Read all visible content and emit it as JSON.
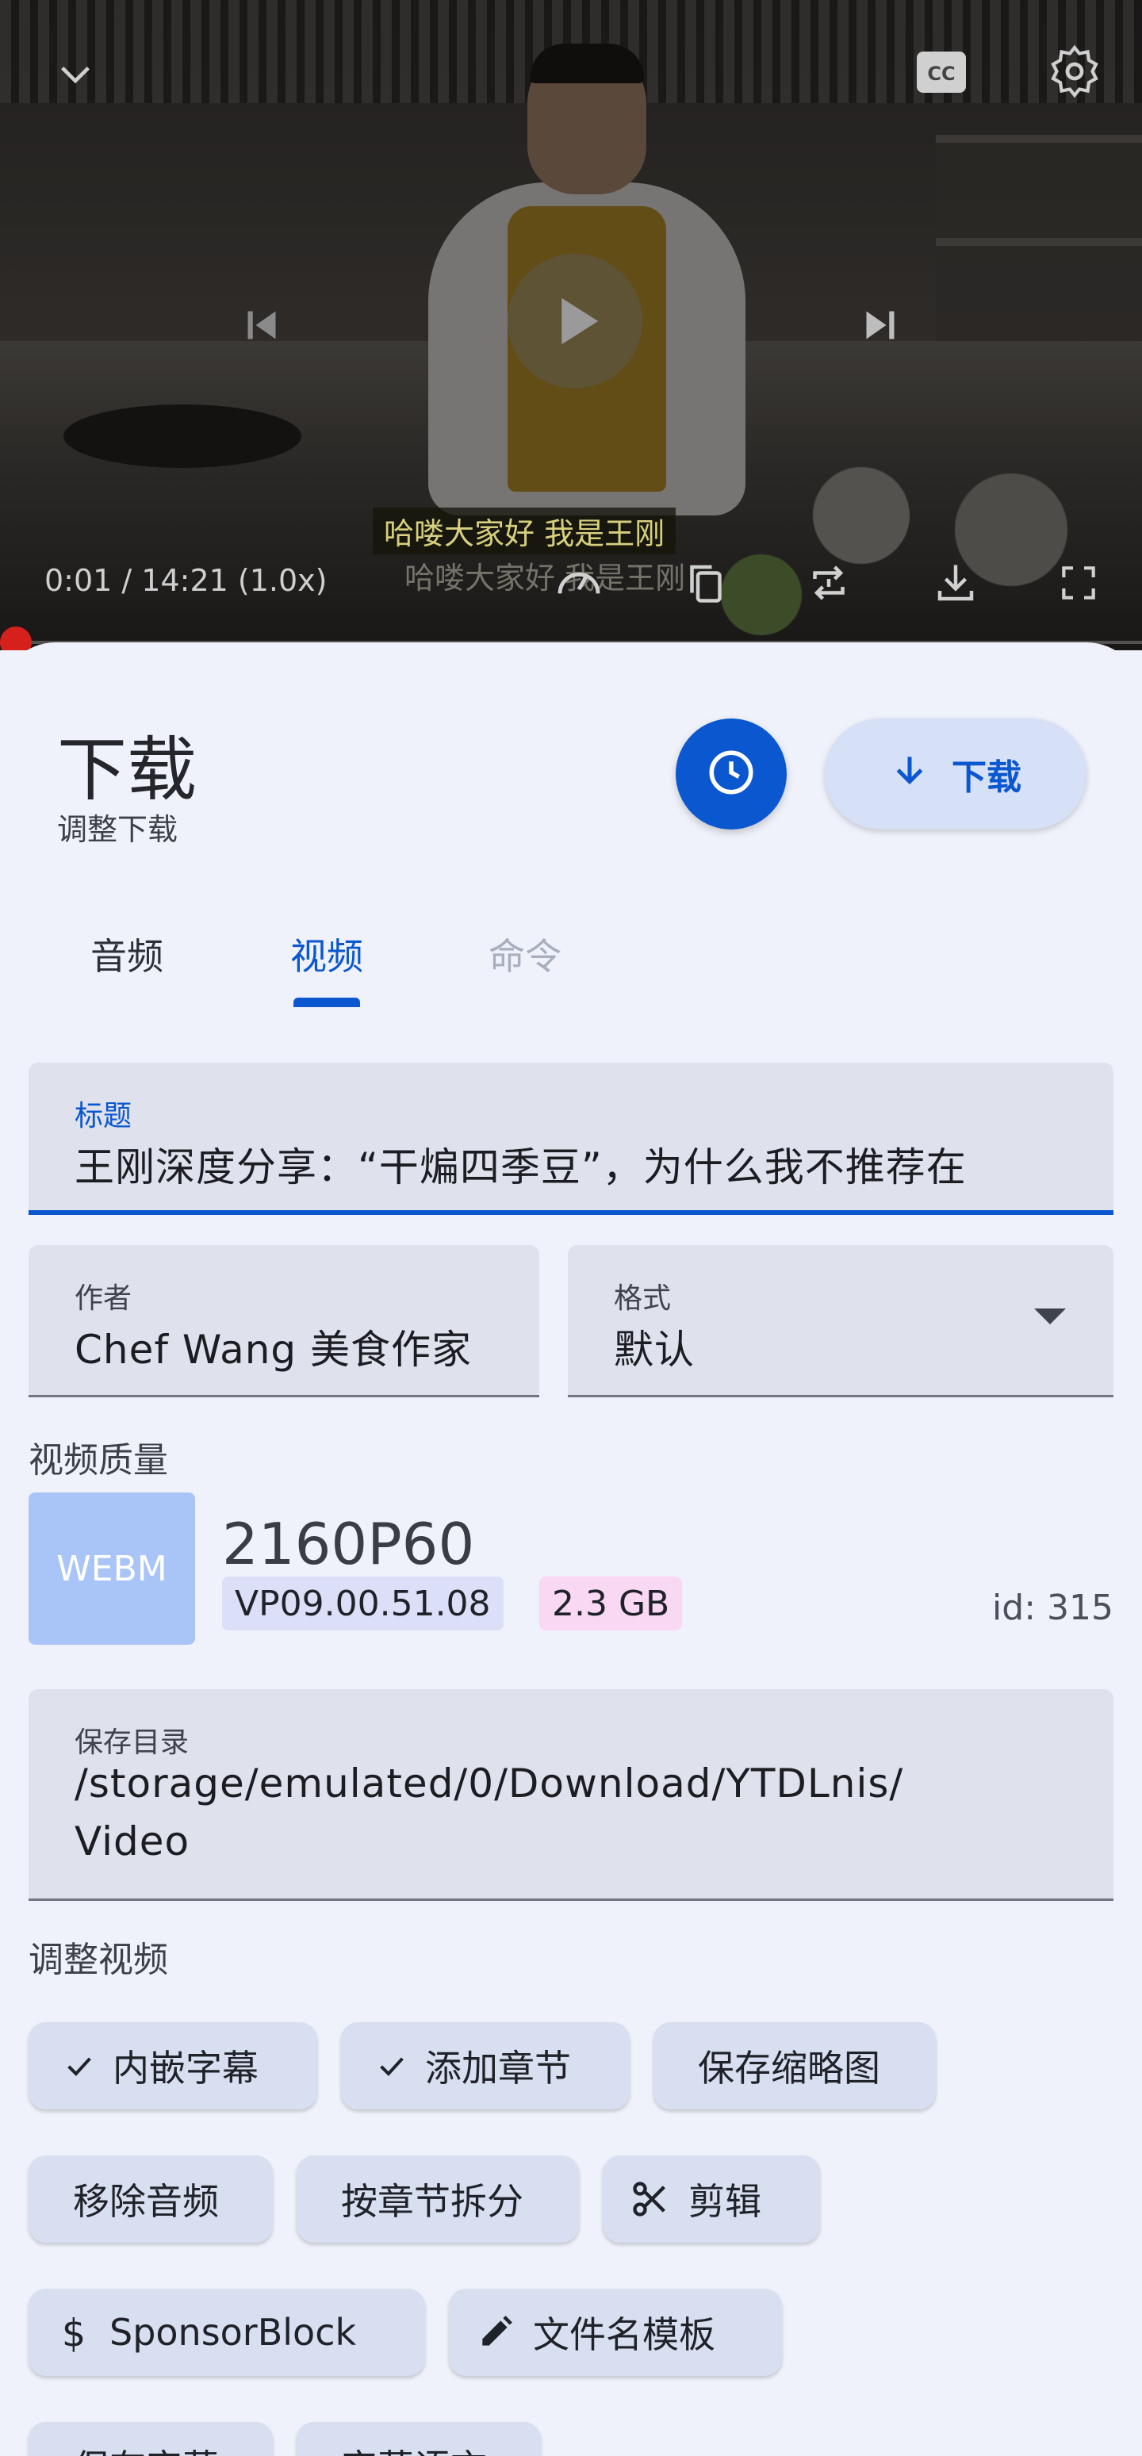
{
  "player": {
    "subtitle_line1": "哈喽大家好 我是王刚",
    "subtitle_line2": "哈喽大家好 我是王刚",
    "timecode": "0:01 / 14:21 (1.0x)",
    "icons": [
      "chevron-down-icon",
      "cc-icon",
      "gear-icon",
      "skip-previous-icon",
      "play-icon",
      "skip-next-icon",
      "speed-icon",
      "copy-icon",
      "repeat-icon",
      "download-icon",
      "fullscreen-icon"
    ]
  },
  "sheet": {
    "title": "下载",
    "subtitle": "调整下载",
    "download_label": "下载"
  },
  "tabs": [
    {
      "label": "音频",
      "state": "default"
    },
    {
      "label": "视频",
      "state": "selected"
    },
    {
      "label": "命令",
      "state": "disabled"
    }
  ],
  "fields": {
    "title": {
      "label": "标题",
      "value": "王刚深度分享：“干煸四季豆”，为什么我不推荐在"
    },
    "author": {
      "label": "作者",
      "value": "Chef Wang 美食作家"
    },
    "format": {
      "label": "格式",
      "value": "默认"
    },
    "save_dir": {
      "label": "保存目录",
      "value_line1": "/storage/emulated/0/Download/YTDLnis/",
      "value_line2": "Video"
    }
  },
  "quality": {
    "section_label": "视频质量",
    "container": "WEBM",
    "name": "2160P60",
    "codec": "VP09.00.51.08",
    "size": "2.3 GB",
    "id": "id: 315"
  },
  "adjust": {
    "section_label": "调整视频",
    "chips": [
      {
        "label": "内嵌字幕",
        "icon": "check-icon",
        "checked": true
      },
      {
        "label": "添加章节",
        "icon": "check-icon",
        "checked": true
      },
      {
        "label": "保存缩略图",
        "checked": false
      },
      {
        "label": "移除音频",
        "checked": false
      },
      {
        "label": "按章节拆分",
        "checked": false
      },
      {
        "label": "剪辑",
        "icon": "scissors-icon",
        "checked": false
      },
      {
        "label": "SponsorBlock",
        "icon": "dollar-icon",
        "checked": false
      },
      {
        "label": "文件名模板",
        "icon": "pencil-icon",
        "checked": false
      },
      {
        "label": "保存字幕",
        "checked": false
      },
      {
        "label": "字幕语言",
        "checked": false
      }
    ]
  },
  "colors": {
    "primary": "#0b57cf",
    "sheet_bg": "#f0f2fb",
    "chip_bg": "#d7dff0",
    "field_bg": "#dfe2ec",
    "codec_tag_bg": "#dbe0f8",
    "size_tag_bg": "#f9d8f3",
    "progress_red": "#d6201c"
  }
}
